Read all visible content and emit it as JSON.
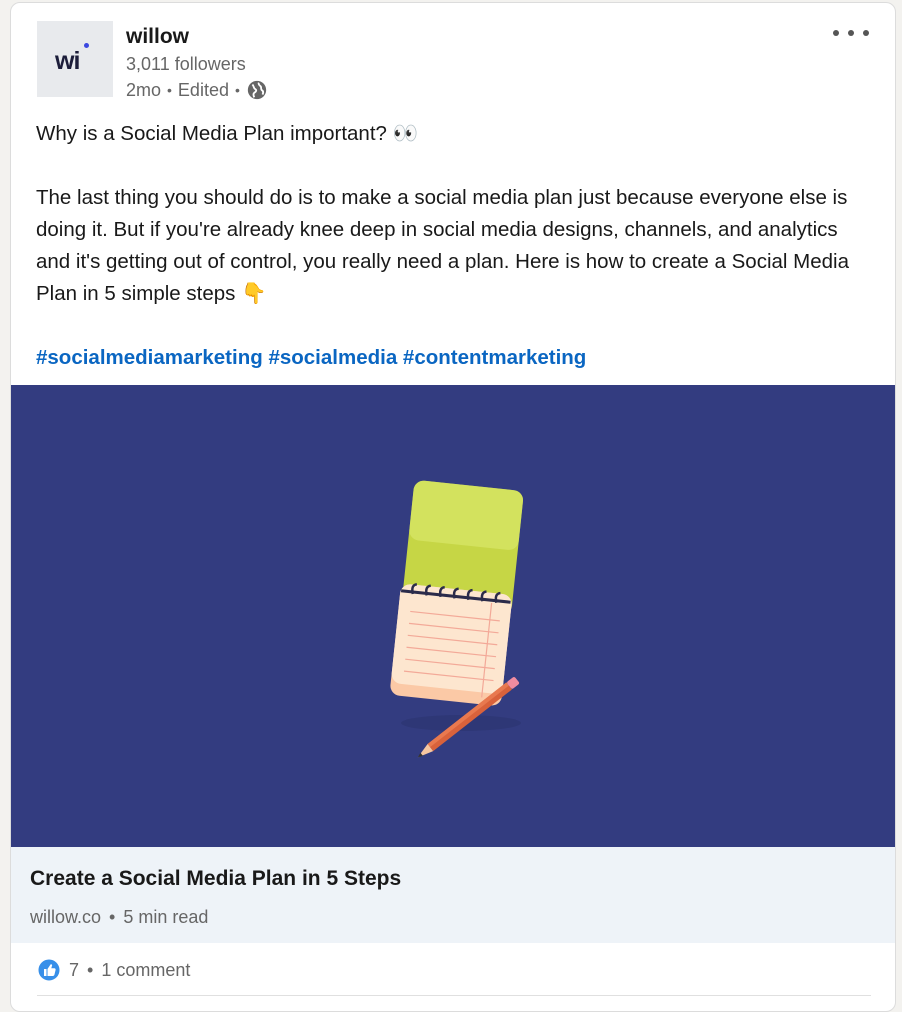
{
  "author": {
    "logo_text": "wi",
    "name": "willow",
    "followers": "3,011 followers",
    "time": "2mo",
    "edited": "Edited",
    "separator": "•",
    "visibility_icon": "globe-icon"
  },
  "post": {
    "headline": "Why is a Social Media Plan important? 👀",
    "body": "The last thing you should do is to make a social media plan just because everyone else is doing it. But if you're already knee deep in social media designs, channels, and analytics and it's getting out of control, you really need a plan. Here is how to create a Social Media Plan in 5 simple steps 👇",
    "hashtags": [
      "#socialmediamarketing",
      "#socialmedia",
      "#contentmarketing"
    ]
  },
  "link_preview": {
    "title": "Create a Social Media Plan in 5 Steps",
    "domain": "willow.co",
    "separator": "•",
    "read_time": "5 min read"
  },
  "social": {
    "reaction_icon": "like-icon",
    "reactions": "7",
    "separator": "•",
    "comments": "1 comment"
  },
  "colors": {
    "link_blue": "#0a66c2",
    "media_background": "#333c80",
    "preview_background": "#eef3f8",
    "notebook_cover": "#d4e157",
    "notebook_page": "#fde6cf"
  }
}
